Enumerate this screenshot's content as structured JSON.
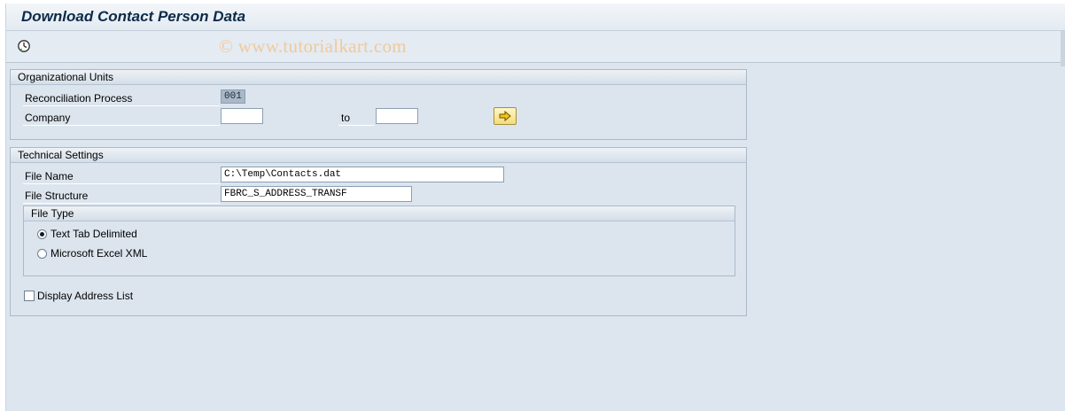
{
  "title": "Download Contact Person Data",
  "watermark": "© www.tutorialkart.com",
  "toolbar": {
    "execute_icon": "execute-clock-icon"
  },
  "org_units": {
    "header": "Organizational Units",
    "reconciliation_label": "Reconciliation Process",
    "reconciliation_value": "001",
    "company_label": "Company",
    "company_from": "",
    "to_label": "to",
    "company_to": "",
    "multiple_selection_icon": "arrow-right-icon"
  },
  "technical": {
    "header": "Technical Settings",
    "file_name_label": "File Name",
    "file_name_value": "C:\\Temp\\Contacts.dat",
    "file_structure_label": "File Structure",
    "file_structure_value": "FBRC_S_ADDRESS_TRANSF",
    "file_type": {
      "header": "File Type",
      "options": [
        {
          "label": "Text Tab Delimited",
          "selected": true
        },
        {
          "label": "Microsoft Excel XML",
          "selected": false
        }
      ]
    },
    "display_address_list_label": "Display Address List",
    "display_address_list_checked": false
  },
  "colors": {
    "background": "#dde6ef",
    "title_text": "#0c2a4a",
    "watermark": "#f1c99a",
    "button_yellow": "#f4dc7a"
  }
}
